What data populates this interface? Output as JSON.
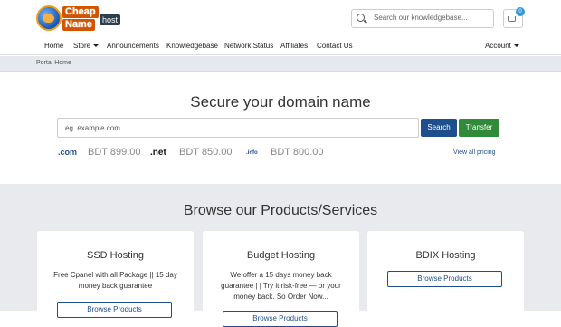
{
  "brand": {
    "line1": "Cheap",
    "line2": "Name",
    "badge": "host"
  },
  "search": {
    "placeholder": "Search our knowledgebase..."
  },
  "cart": {
    "count": "0"
  },
  "nav": {
    "items": [
      "Home",
      "Store",
      "Announcements",
      "Knowledgebase",
      "Network Status",
      "Affiliates",
      "Contact Us"
    ],
    "account": "Account"
  },
  "breadcrumb": "Portal Home",
  "domain": {
    "title": "Secure your domain name",
    "placeholder": "eg. example.com",
    "search_label": "Search",
    "transfer_label": "Transfer",
    "tlds": [
      {
        "name": ".com",
        "price": "BDT 899.00"
      },
      {
        "name": ".net",
        "price": "BDT 850.00"
      },
      {
        "name": ".info",
        "price": "BDT 800.00"
      }
    ],
    "view_pricing": "View all pricing"
  },
  "products": {
    "title": "Browse our Products/Services",
    "cards": [
      {
        "title": "SSD Hosting",
        "desc": "Free Cpanel with all Package || 15 day money back guarantee",
        "button": "Browse Products"
      },
      {
        "title": "Budget Hosting",
        "desc": "We offer a 15 days money back guarantee | | Try it risk-free — or your money back. So Order Now...",
        "button": "Browse Products"
      },
      {
        "title": "BDIX Hosting",
        "desc": "",
        "button": "Browse Products"
      }
    ]
  },
  "colors": {
    "primary": "#1f4e8c",
    "success": "#2f8a3a",
    "accent": "#d35400"
  }
}
